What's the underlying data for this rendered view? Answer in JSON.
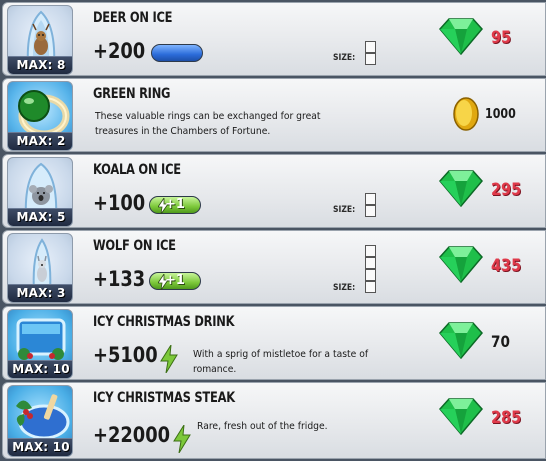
{
  "items": [
    {
      "title": "DEER ON ICE",
      "max": "MAX: 8",
      "bonus": "+200",
      "size_label": "SIZE:",
      "price": "95",
      "currency": "gem-icon"
    },
    {
      "title": "GREEN RING",
      "max": "MAX: 2",
      "description_line1": "These valuable rings can be exchanged for great",
      "description_line2": "treasures in the Chambers of Fortune.",
      "price": "1000",
      "currency": "coin-icon"
    },
    {
      "title": "KOALA ON ICE",
      "max": "MAX: 5",
      "bonus": "+100",
      "energy_badge": "+1",
      "size_label": "SIZE:",
      "price": "295",
      "currency": "gem-icon"
    },
    {
      "title": "WOLF ON ICE",
      "max": "MAX: 3",
      "bonus": "+133",
      "energy_badge": "+1",
      "size_label": "SIZE:",
      "price": "435",
      "currency": "gem-icon"
    },
    {
      "title": "ICY CHRISTMAS DRINK",
      "max": "MAX: 10",
      "bonus": "+5100",
      "description_line1": "With a sprig of mistletoe for a taste of",
      "description_line2": "romance.",
      "price": "70",
      "currency": "gem-icon"
    },
    {
      "title": "ICY CHRISTMAS STEAK",
      "max": "MAX: 10",
      "bonus": "+22000",
      "description_line1": "Rare, fresh out of the fridge.",
      "price": "285",
      "currency": "gem-icon"
    }
  ],
  "colors": {
    "gem": "#1fbf4a",
    "price_red": "#e03a4a",
    "coin": "#f2c21a"
  }
}
